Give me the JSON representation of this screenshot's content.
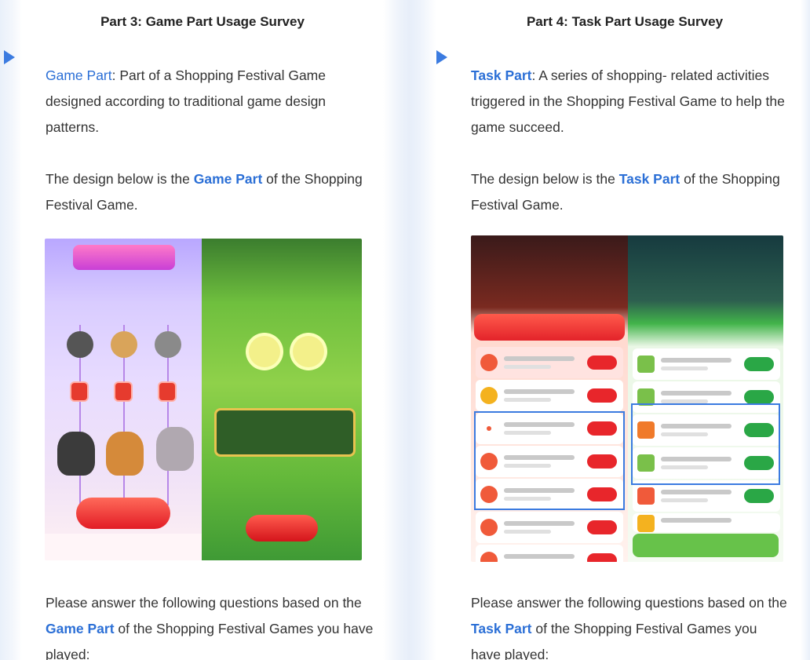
{
  "colors": {
    "accent": "#2b6fd6",
    "arrow": "#3b7be0"
  },
  "panels": [
    {
      "title_prefix": "Part 3: ",
      "title_bold": "Game Part",
      "title_suffix": " Usage Survey",
      "def_term": "Game Part",
      "def_text": ": Part of a Shopping Festival Game designed according to traditional game design patterns.",
      "design_prefix": "The design below is the ",
      "design_term": "Game Part",
      "design_suffix": " of the Shopping Festival Game.",
      "answer_prefix": "Please answer the following questions based on the ",
      "answer_term": "Game Part",
      "answer_suffix": " of the Shopping Festival Games you have played:"
    },
    {
      "title_prefix": "Part 4: ",
      "title_bold": "Task Part",
      "title_suffix": " Usage Survey",
      "def_term": "Task Part",
      "def_text": ": A series of shopping- related activities triggered in the Shopping Festival Game to help the game succeed.",
      "design_prefix": "The design below is the ",
      "design_term": "Task Part",
      "design_suffix": " of the Shopping Festival Game.",
      "answer_prefix": "Please answer the following questions based on the ",
      "answer_term": "Task Part",
      "answer_suffix": " of the Shopping Festival Games you have played:"
    }
  ]
}
